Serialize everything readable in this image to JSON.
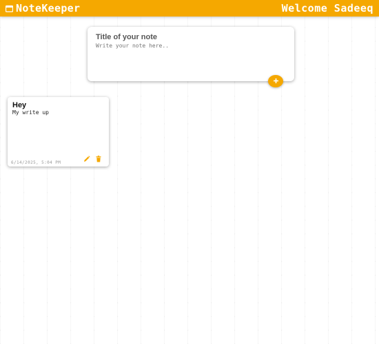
{
  "header": {
    "brand_icon": "note-icon",
    "brand": "NoteKeeper",
    "welcome": "Welcome Sadeeq"
  },
  "create_note": {
    "title_placeholder": "Title of your note",
    "content_placeholder": "Write your note here..",
    "add_icon": "plus-icon"
  },
  "notes": [
    {
      "title": "Hey",
      "content": "My write up",
      "date": "6/14/2025, 5:04 PM",
      "edit_icon": "pencil-icon",
      "delete_icon": "trash-icon"
    }
  ],
  "colors": {
    "accent": "#f5a800",
    "header_text": "#ffffff"
  }
}
